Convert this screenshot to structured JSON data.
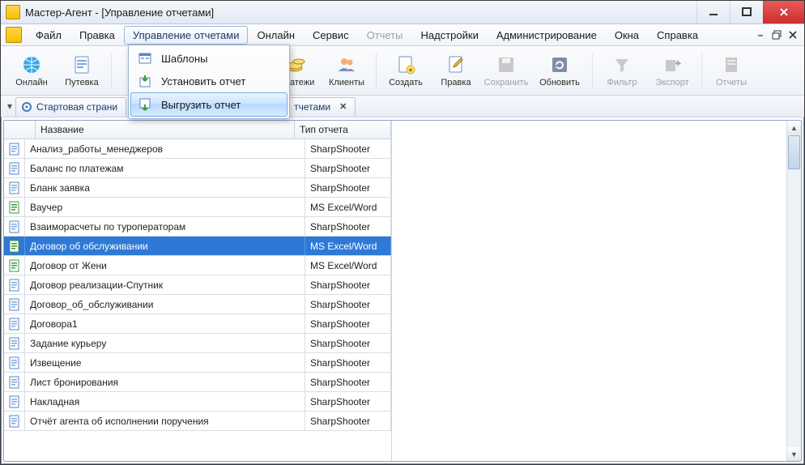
{
  "window": {
    "title": "Мастер-Агент - [Управление отчетами]"
  },
  "menu": {
    "items": [
      "Файл",
      "Правка",
      "Управление отчетами",
      "Онлайн",
      "Сервис",
      "Отчеты",
      "Надстройки",
      "Администрирование",
      "Окна",
      "Справка"
    ],
    "open_index": 2,
    "disabled_index": 5
  },
  "dropdown": {
    "items": [
      "Шаблоны",
      "Установить отчет",
      "Выгрузить отчет"
    ],
    "highlight_index": 2
  },
  "toolbar": {
    "online": "Онлайн",
    "voucher": "Путевка",
    "payments": "Платежи",
    "clients": "Клиенты",
    "create": "Создать",
    "edit": "Правка",
    "save": "Сохранить",
    "update": "Обновить",
    "filter": "Фильтр",
    "export": "Экспорт",
    "reports": "Отчеты"
  },
  "tabs": {
    "start": "Стартовая страни",
    "reports_partial": "тчетами"
  },
  "grid": {
    "columns": {
      "name": "Название",
      "type": "Тип отчета"
    },
    "selected_index": 5,
    "rows": [
      {
        "name": "Анализ_работы_менеджеров",
        "type": "SharpShooter",
        "icon": "blue"
      },
      {
        "name": "Баланс по платежам",
        "type": "SharpShooter",
        "icon": "blue"
      },
      {
        "name": "Бланк заявка",
        "type": "SharpShooter",
        "icon": "blue"
      },
      {
        "name": "Ваучер",
        "type": "MS Excel/Word",
        "icon": "green"
      },
      {
        "name": "Взаиморасчеты по туроператорам",
        "type": "SharpShooter",
        "icon": "blue"
      },
      {
        "name": "Договор об обслуживании",
        "type": "MS Excel/Word",
        "icon": "green"
      },
      {
        "name": "Договор от Жени",
        "type": "MS Excel/Word",
        "icon": "green"
      },
      {
        "name": "Договор реализации-Спутник",
        "type": "SharpShooter",
        "icon": "blue"
      },
      {
        "name": "Договор_об_обслуживании",
        "type": "SharpShooter",
        "icon": "blue"
      },
      {
        "name": "Договора1",
        "type": "SharpShooter",
        "icon": "blue"
      },
      {
        "name": "Задание курьеру",
        "type": "SharpShooter",
        "icon": "blue"
      },
      {
        "name": "Извещение",
        "type": "SharpShooter",
        "icon": "blue"
      },
      {
        "name": "Лист бронирования",
        "type": "SharpShooter",
        "icon": "blue"
      },
      {
        "name": "Накладная",
        "type": "SharpShooter",
        "icon": "blue"
      },
      {
        "name": "Отчёт агента об исполнении поручения",
        "type": "SharpShooter",
        "icon": "blue"
      }
    ]
  }
}
